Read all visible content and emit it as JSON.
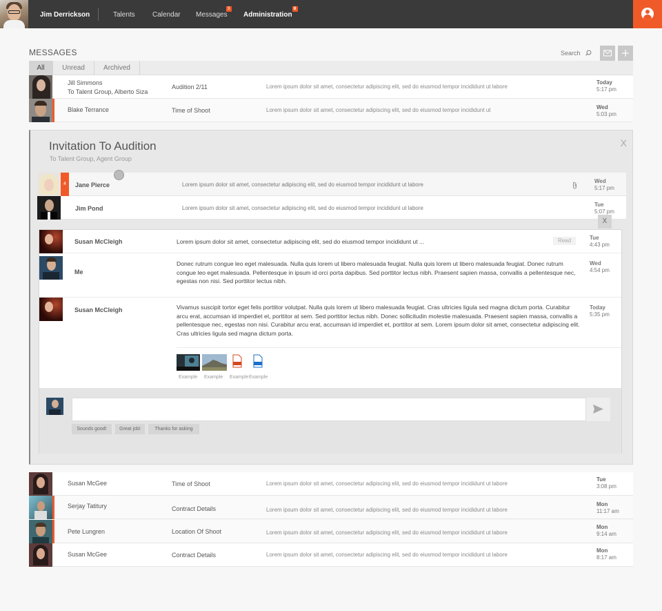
{
  "topbar": {
    "user_name": "Jim Derrickson",
    "nav": [
      {
        "label": "Talents",
        "badge": ""
      },
      {
        "label": "Calendar",
        "badge": ""
      },
      {
        "label": "Messages",
        "badge": "3"
      },
      {
        "label": "Administration",
        "badge": "8"
      }
    ]
  },
  "header": {
    "title": "MESSAGES",
    "search_label": "Search"
  },
  "tabs": [
    "All",
    "Unread",
    "Archived"
  ],
  "rows_top": [
    {
      "sender": "Jill Simmons",
      "sender_line2": "To Talent Group, Alberto Siza",
      "subject": "Audition 2/11",
      "preview": "Lorem ipsum dolor sit amet, consectetur adipiscing elit, sed do eiusmod tempor incididunt ut labore",
      "day": "Today",
      "time": "5:17 pm"
    },
    {
      "sender": "Blake Terrance",
      "subject": "Time of Shoot",
      "preview": "Lorem ipsum dolor sit amet, consectetur adipiscing elit, sed do eiusmod tempor incididunt ut",
      "day": "Wed",
      "time": "5:03 pm"
    }
  ],
  "thread": {
    "title": "Invitation To Audition",
    "subtitle": "To Talent Group, Agent Group",
    "close": "X",
    "subrows": [
      {
        "sender": "Jane Pierce",
        "count": "4",
        "preview": "Lorem ipsum dolor sit amet, consectetur adipiscing elit, sed do eiusmod tempor incididunt ut labore",
        "day": "Wed",
        "time": "5:17 pm"
      },
      {
        "sender": "Jim Pond",
        "preview": "Lorem ipsum dolor sit amet, consectetur adipiscing elit, sed do eiusmod tempor incididunt ut labore",
        "day": "Tue",
        "time": "5:07 pm"
      }
    ],
    "conversation": {
      "close": "X",
      "messages": [
        {
          "name": "Susan McCleigh",
          "body": "Lorem ipsum dolor sit amet, consectetur adipiscing elit, sed do eiusmod tempor incididunt ut ...",
          "badge": "Read",
          "day": "Tue",
          "time": "4:43 pm"
        },
        {
          "name": "Me",
          "body": "Donec rutrum congue leo eget malesuada. Nulla quis lorem ut libero malesuada feugiat. Nulla quis lorem ut libero malesuada feugiat. Donec rutrum congue leo eget malesuada. Pellentesque in ipsum id orci porta dapibus. Sed porttitor lectus nibh. Praesent sapien massa, convallis a pellentesque nec, egestas non nisi. Sed porttitor lectus nibh.",
          "day": "Wed",
          "time": "4:54 pm"
        },
        {
          "name": "Susan McCleigh",
          "body": "Vivamus suscipit tortor eget felis porttitor volutpat. Nulla quis lorem ut libero malesuada feugiat. Cras ultricies ligula sed magna dictum porta. Curabitur arcu erat, accumsan id imperdiet et, porttitor at sem. Sed porttitor lectus nibh. Donec sollicitudin molestie malesuada. Praesent sapien massa, convallis a pellentesque nec, egestas non nisi. Curabitur arcu erat, accumsan id imperdiet et, porttitor at sem. Lorem ipsum dolor sit amet, consectetur adipiscing elit. Cras ultricies ligula sed magna dictum porta.",
          "day": "Today",
          "time": "5:35 pm"
        }
      ],
      "attachments": [
        {
          "label": "Example",
          "kind": "image-dark"
        },
        {
          "label": "Example",
          "kind": "image-landscape"
        },
        {
          "label": "Example",
          "kind": "pdf-file"
        },
        {
          "label": "Example",
          "kind": "doc-file"
        }
      ],
      "quick_replies": [
        "Sounds good!",
        "Great job!",
        "Thanks for asking"
      ]
    }
  },
  "rows_bottom": [
    {
      "sender": "Susan McGee",
      "subject": "Time of Shoot",
      "preview": "Lorem ipsum dolor sit amet, consectetur adipiscing elit, sed do eiusmod tempor incididunt ut labore",
      "day": "Tue",
      "time": "3:08 pm"
    },
    {
      "sender": "Serjay Tatitury",
      "subject": "Contract Details",
      "preview": "Lorem ipsum dolor sit amet, consectetur adipiscing elit, sed do eiusmod tempor incididunt ut labore",
      "day": "Mon",
      "time": "11:17 am"
    },
    {
      "sender": "Pete Lungren",
      "subject": "Location Of Shoot",
      "preview": "Lorem ipsum dolor sit amet, consectetur adipiscing elit, sed do eiusmod tempor incididunt ut labore",
      "day": "Mon",
      "time": "9:14 am"
    },
    {
      "sender": "Susan McGee",
      "subject": "Contract Details",
      "preview": "Lorem ipsum dolor sit amet, consectetur adipiscing elit, sed do eiusmod tempor incididunt ut labore",
      "day": "Mon",
      "time": "8:17 am"
    }
  ],
  "colors": {
    "accent": "#f05a28",
    "topbar": "#3a3a3a"
  }
}
